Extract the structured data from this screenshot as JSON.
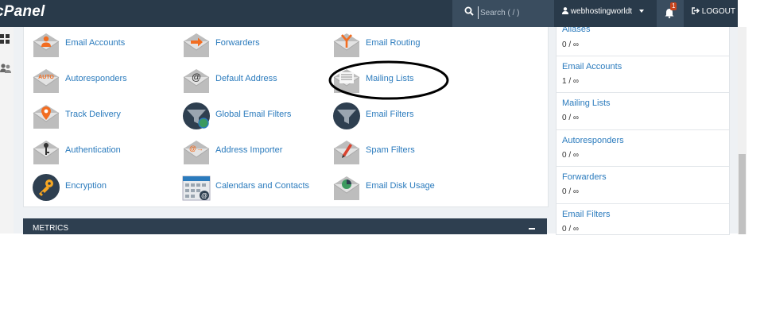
{
  "header": {
    "logo": "cPanel",
    "search_placeholder": "Search ( / )",
    "username": "webhostingworldt",
    "notification_count": "1",
    "logout_label": "LOGOUT"
  },
  "email_section": {
    "items": [
      {
        "label": "Email Accounts",
        "icon": "email-accounts-icon"
      },
      {
        "label": "Forwarders",
        "icon": "forwarders-icon"
      },
      {
        "label": "Email Routing",
        "icon": "email-routing-icon"
      },
      {
        "label": "Autoresponders",
        "icon": "autoresponders-icon"
      },
      {
        "label": "Default Address",
        "icon": "default-address-icon"
      },
      {
        "label": "Mailing Lists",
        "icon": "mailing-lists-icon"
      },
      {
        "label": "Track Delivery",
        "icon": "track-delivery-icon"
      },
      {
        "label": "Global Email Filters",
        "icon": "global-email-filters-icon"
      },
      {
        "label": "Email Filters",
        "icon": "email-filters-icon"
      },
      {
        "label": "Authentication",
        "icon": "authentication-icon"
      },
      {
        "label": "Address Importer",
        "icon": "address-importer-icon"
      },
      {
        "label": "Spam Filters",
        "icon": "spam-filters-icon"
      },
      {
        "label": "Encryption",
        "icon": "encryption-icon"
      },
      {
        "label": "Calendars and Contacts",
        "icon": "calendars-contacts-icon"
      },
      {
        "label": "Email Disk Usage",
        "icon": "email-disk-usage-icon"
      }
    ],
    "icon_text": {
      "auto": "AUTO",
      "at": "@",
      "at_arrow": "@→"
    }
  },
  "metrics": {
    "title": "METRICS"
  },
  "stats": [
    {
      "label": "Aliases",
      "value": "0 / ∞"
    },
    {
      "label": "Email Accounts",
      "value": "1 / ∞"
    },
    {
      "label": "Mailing Lists",
      "value": "0 / ∞"
    },
    {
      "label": "Autoresponders",
      "value": "0 / ∞"
    },
    {
      "label": "Forwarders",
      "value": "0 / ∞"
    },
    {
      "label": "Email Filters",
      "value": "0 / ∞"
    }
  ],
  "colors": {
    "topbar": "#293a4a",
    "link": "#2b7bbd",
    "accent_orange": "#f26d21",
    "badge": "#c6451e"
  }
}
